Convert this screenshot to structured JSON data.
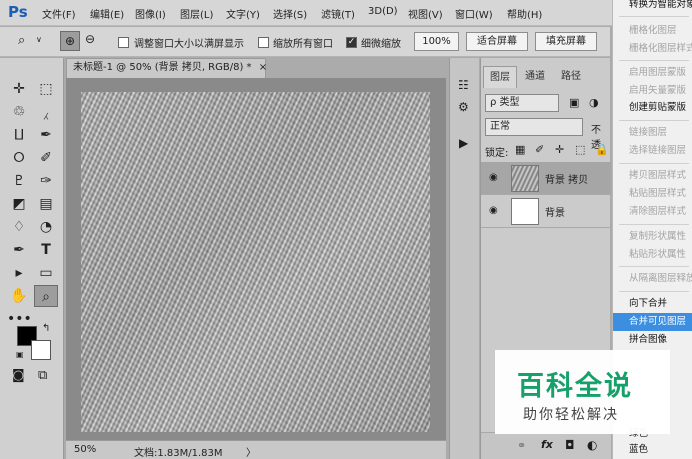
{
  "app": {
    "logo": "Ps"
  },
  "menu": [
    "文件(F)",
    "编辑(E)",
    "图像(I)",
    "图层(L)",
    "文字(Y)",
    "选择(S)",
    "滤镜(T)",
    "3D(D)",
    "视图(V)",
    "窗口(W)",
    "帮助(H)"
  ],
  "options_bar": {
    "resize_windows_label": "调整窗口大小以满屏显示",
    "zoom_all_windows_label": "缩放所有窗口",
    "scrubby_zoom_label": "细微缩放",
    "scrubby_zoom_checked": true,
    "btn_100": "100%",
    "btn_fit": "适合屏幕",
    "btn_fill": "填充屏幕"
  },
  "document": {
    "tab_title": "未标题-1 @ 50% (背景 拷贝, RGB/8) *",
    "tab_close": "×",
    "zoom": "50%",
    "doc_info": "文档:1.83M/1.83M",
    "arrow": "〉"
  },
  "layers_panel": {
    "tabs": [
      "图层",
      "通道",
      "路径"
    ],
    "filter_kind": "ρ 类型",
    "blend_mode": "正常",
    "opacity_label": "不透",
    "lock_label": "锁定:",
    "layers": [
      {
        "name": "背景 拷贝",
        "selected": true,
        "visible": true
      },
      {
        "name": "背景",
        "selected": false,
        "visible": true
      }
    ],
    "footer_icons": [
      "link-icon",
      "fx-icon",
      "mask-icon",
      "adjustment-icon"
    ],
    "footer_fx": "fx"
  },
  "context_menu": {
    "items": [
      {
        "label": "转换为智能对象",
        "state": "enabled"
      },
      {
        "label": "栅格化图层",
        "state": "disabled"
      },
      {
        "label": "栅格化图层样式",
        "state": "disabled"
      },
      {
        "label": "启用图层蒙版",
        "state": "disabled"
      },
      {
        "label": "启用矢量蒙版",
        "state": "disabled"
      },
      {
        "label": "创建剪贴蒙版",
        "state": "enabled"
      },
      {
        "label": "链接图层",
        "state": "disabled"
      },
      {
        "label": "选择链接图层",
        "state": "disabled"
      },
      {
        "label": "拷贝图层样式",
        "state": "disabled"
      },
      {
        "label": "粘贴图层样式",
        "state": "disabled"
      },
      {
        "label": "清除图层样式",
        "state": "disabled"
      },
      {
        "label": "复制形状属性",
        "state": "disabled"
      },
      {
        "label": "粘贴形状属性",
        "state": "disabled"
      },
      {
        "label": "从隔离图层释放",
        "state": "disabled"
      },
      {
        "label": "向下合并",
        "state": "enabled"
      },
      {
        "label": "合并可见图层",
        "state": "highlighted"
      },
      {
        "label": "拼合图像",
        "state": "enabled"
      },
      {
        "label": "绿色",
        "state": "enabled"
      },
      {
        "label": "蓝色",
        "state": "enabled"
      }
    ]
  },
  "watermark": {
    "title": "百科全说",
    "subtitle": "助你轻松解决"
  },
  "colors": {
    "accent": "#3b8ee0",
    "watermark_green": "#16a06a",
    "ps_blue": "#1a5fb4"
  }
}
